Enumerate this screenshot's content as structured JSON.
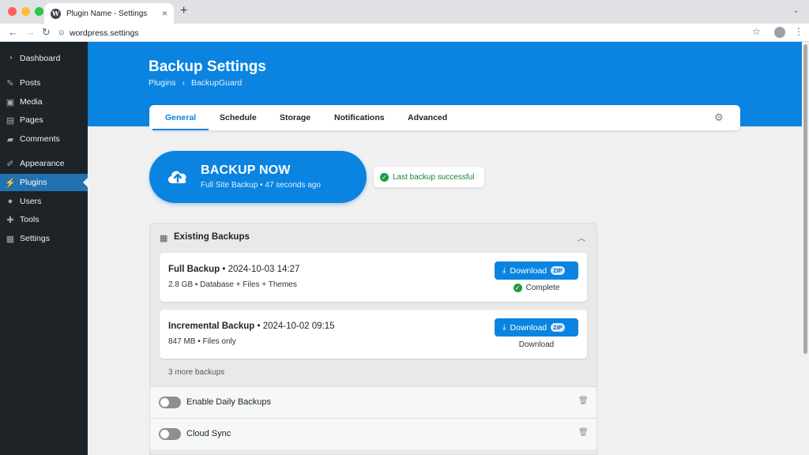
{
  "browser": {
    "tab_title": "Plugin Name - Settings",
    "tab_close": "×",
    "new_tab": "+",
    "tab_menu": "⌄",
    "url": "wordpress.settings",
    "traffic_colors": [
      "#ff5f57",
      "#febc2e",
      "#28c840"
    ]
  },
  "sidebar": {
    "items": [
      {
        "label": "Dashboard",
        "icon": "dashboard-icon",
        "glyph": "◔"
      },
      {
        "label": "Posts",
        "icon": "pin-icon",
        "glyph": "✎"
      },
      {
        "label": "Media",
        "icon": "media-icon",
        "glyph": "▣"
      },
      {
        "label": "Pages",
        "icon": "pages-icon",
        "glyph": "▤"
      },
      {
        "label": "Comments",
        "icon": "comment-icon",
        "glyph": "▰"
      },
      {
        "label": "Appearance",
        "icon": "brush-icon",
        "glyph": "✐"
      },
      {
        "label": "Plugins",
        "icon": "plugin-icon",
        "glyph": "⚡",
        "active": true
      },
      {
        "label": "Users",
        "icon": "users-icon",
        "glyph": "●"
      },
      {
        "label": "Tools",
        "icon": "wrench-icon",
        "glyph": "✚"
      },
      {
        "label": "Settings",
        "icon": "settings-icon",
        "glyph": "▦"
      }
    ]
  },
  "header": {
    "title": "Backup Settings",
    "breadcrumb": [
      "Plugins",
      "BackupGuard"
    ],
    "breadcrumb_sep": "›"
  },
  "tabs": [
    "General",
    "Schedule",
    "Storage",
    "Notifications",
    "Advanced"
  ],
  "active_tab": "General",
  "backup_now": {
    "title": "BACKUP NOW",
    "subtitle": "Full Site Backup • 47 seconds ago"
  },
  "status": {
    "text": "Last backup successful",
    "color": "#1a7f37"
  },
  "existing": {
    "title": "Existing Backups",
    "backups": [
      {
        "name": "Full Backup",
        "date": "• 2024-10-03 14:27",
        "meta": "2.8 GB • Database + Files + Themes",
        "button": "Download",
        "badge": "ZIP",
        "status": "Complete"
      },
      {
        "name": "Incremental Backup",
        "date": "• 2024-10-02 09:15",
        "meta": "847 MB • Files only",
        "button": "Download",
        "badge": "ZIP",
        "status": "Download"
      }
    ],
    "more": "3 more backups"
  },
  "settings_rows": [
    {
      "label": "Enable Daily Backups",
      "enabled": false
    },
    {
      "label": "Cloud Sync",
      "enabled": false
    }
  ],
  "colors": {
    "accent": "#0a84e0",
    "sidebar_bg": "#1d2327",
    "sidebar_active": "#2271b1"
  }
}
